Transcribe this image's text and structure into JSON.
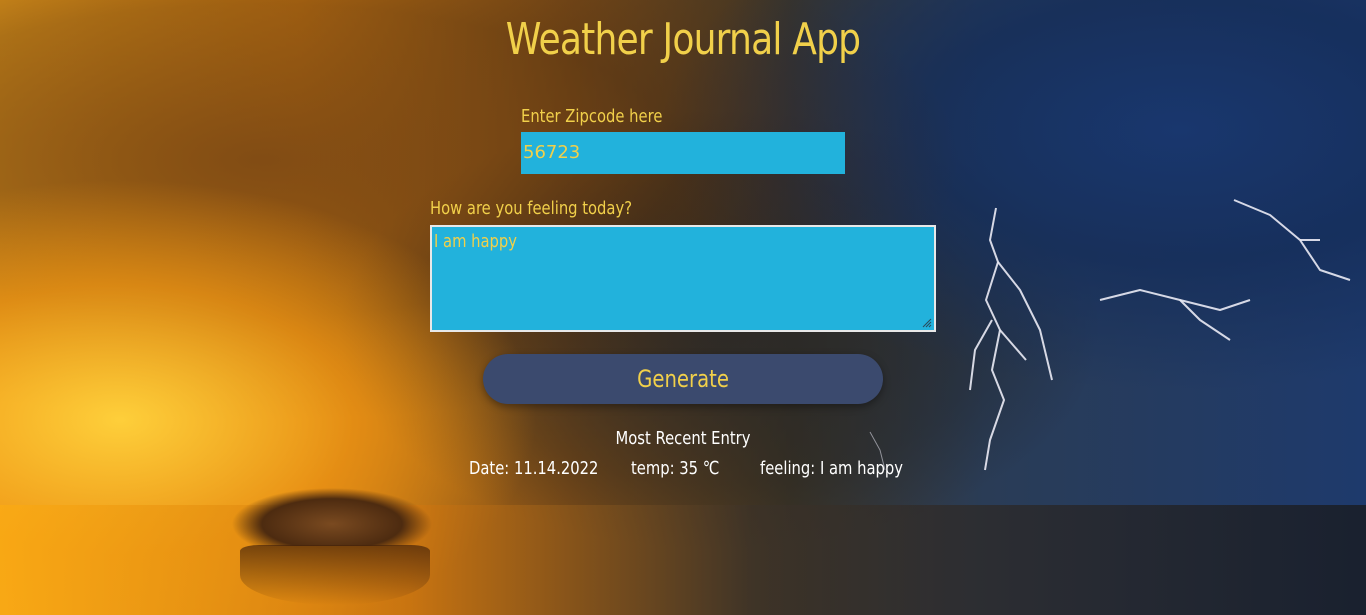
{
  "app": {
    "title": "Weather Journal App"
  },
  "form": {
    "zip_label": "Enter Zipcode here",
    "zip_value": "56723",
    "feeling_label": "How are you feeling today?",
    "feeling_value": "I am happy",
    "generate_label": "Generate"
  },
  "recent": {
    "title": "Most Recent Entry",
    "date": "Date: 11.14.2022",
    "temp": "temp: 35 ℃",
    "feeling": "feeling: I am happy"
  },
  "colors": {
    "accent_text": "#f1d04a",
    "input_bg": "#22b2dc",
    "button_bg": "#3b4a6e",
    "entry_text": "#ffffff"
  },
  "icons": {
    "resize_handle": "resize-grip-icon"
  }
}
